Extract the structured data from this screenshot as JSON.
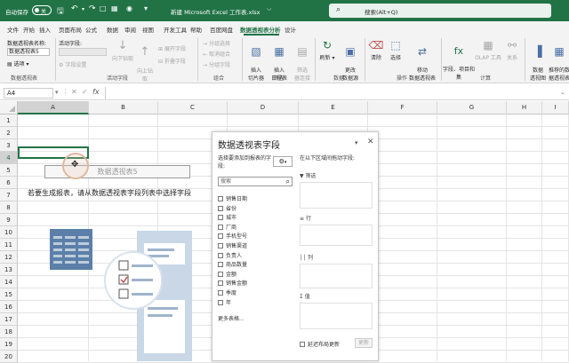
{
  "titlebar": {
    "autosave_label": "自动保存",
    "autosave_state": "关",
    "filename": "新建 Microsoft Excel 工作表.xlsx",
    "search_placeholder": "搜索(Alt+Q)"
  },
  "menu": {
    "items": [
      "文件",
      "开始",
      "插入",
      "页面布局",
      "公式",
      "数据",
      "审阅",
      "视图",
      "开发工具",
      "帮助",
      "百度网盘",
      "数据透视表分析",
      "设计"
    ],
    "active_index": 11
  },
  "ribbon": {
    "pivot_name_label": "数据透视表名称:",
    "pivot_name_value": "数据透视表5",
    "options_label": "选项",
    "group_pivottable": "数据透视表",
    "active_field_label": "活动字段:",
    "field_settings": "字段设置",
    "drill_down": "向下钻取",
    "drill_up": "向上钻\n取",
    "expand_field": "展开字段",
    "collapse_field": "折叠字段",
    "group_active_field": "活动字段",
    "group_selection": "分组选择",
    "ungroup": "取消组合",
    "group_field": "分组字段",
    "group_group": "组合",
    "insert_slicer": "插入\n切片器",
    "insert_timeline": "插入\n日程表",
    "filter_connections": "筛选\n器连接",
    "group_filter": "筛选",
    "refresh": "刷新",
    "change_source": "更改\n数据源",
    "group_data": "数据",
    "clear": "清除",
    "select": "选择",
    "move_pivot": "移动\n数据透视表",
    "group_actions": "操作",
    "fields_items_sets": "字段、项目和\n集",
    "olap_tools": "OLAP 工具",
    "relationships": "关系",
    "group_calculations": "计算",
    "pivot_chart": "数据\n透视图",
    "recommended": "推荐的数\n据透视表"
  },
  "formula_bar": {
    "name_box": "A4",
    "fx": "fx",
    "value": ""
  },
  "sheet": {
    "columns": [
      "A",
      "B",
      "C",
      "D",
      "E",
      "F",
      "G",
      "H",
      "I"
    ],
    "rows": [
      "1",
      "2",
      "3",
      "4",
      "5",
      "6",
      "7",
      "8",
      "9",
      "10",
      "11",
      "12",
      "13",
      "14",
      "15",
      "16",
      "17",
      "18",
      "19",
      "20"
    ],
    "selected_cell": "A4",
    "pivot_placeholder": "数据透视表5",
    "instruction": "若要生成报表，请从数据透视表字段列表中选择字段"
  },
  "pane": {
    "title": "数据透视表字段",
    "choose_label": "选择要添加到报表的字段:",
    "search_placeholder": "搜索",
    "fields": [
      "销售日期",
      "省份",
      "城市",
      "厂商",
      "手机型号",
      "销售渠道",
      "负责人",
      "商品数量",
      "金额",
      "销售金额",
      "季度",
      "年"
    ],
    "more_tables": "更多表格...",
    "drag_label": "在以下区域间拖动字段:",
    "area_filter": "筛选",
    "area_rows": "行",
    "area_columns": "列",
    "area_values": "值",
    "defer_label": "延迟布局更新",
    "update_button": "更新"
  },
  "colors": {
    "excel_green": "#217346",
    "pane_accent": "#217346",
    "illustration_blue": "#5b7fa8"
  }
}
